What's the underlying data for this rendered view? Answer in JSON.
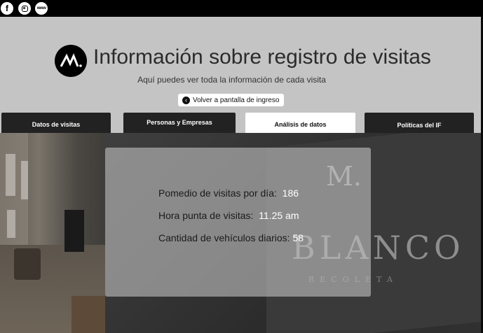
{
  "social": {
    "facebook_icon": "f",
    "web_label": "www"
  },
  "logo_text": "M.",
  "header": {
    "title": "Información sobre registro de visitas",
    "subtitle": "Aquí puedes ver toda la información de cada visita",
    "back_button_label": "Volver a pantalla de ingreso"
  },
  "tabs": [
    {
      "label": "Datos de visitas",
      "active": false
    },
    {
      "label": "Personas y Empresas",
      "active": false
    },
    {
      "label": "Análisis de datos",
      "active": true
    },
    {
      "label": "Políticas del IF",
      "active": false
    }
  ],
  "stats": [
    {
      "label": "Pomedio de visitas por día:",
      "value": "186"
    },
    {
      "label": "Hora punta de visitas:",
      "value": "11.25 am"
    },
    {
      "label": "Cantidad de vehículos diarios:",
      "value": "58"
    }
  ],
  "background_sign": {
    "mark": "M.",
    "name": "BLANCO",
    "subtitle": "RECOLETA"
  },
  "colors": {
    "header_bg": "#c4c4c4",
    "tab_bg": "#222222",
    "tab_active_bg": "#ffffff",
    "stat_value": "#ffffff"
  }
}
